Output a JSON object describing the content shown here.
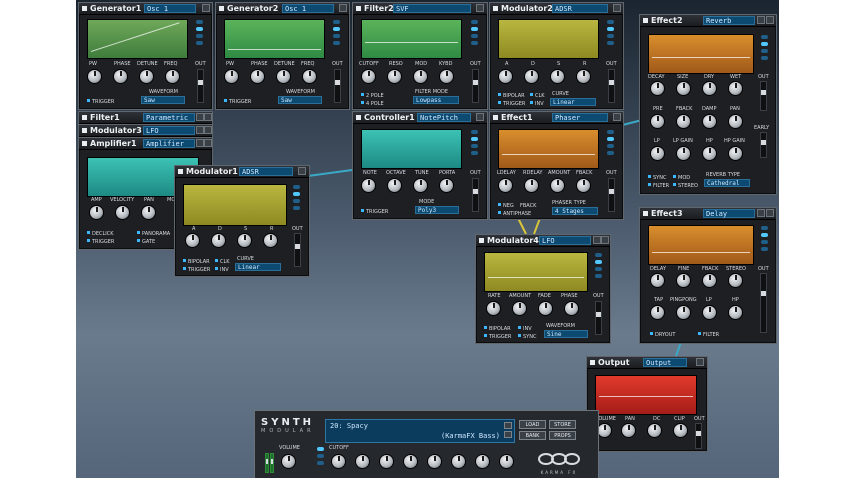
{
  "modules": {
    "generator1": {
      "title": "Generator1",
      "select": "Osc 1",
      "knobs": [
        "PW",
        "PHASE",
        "DETUNE",
        "FREQ"
      ],
      "out": "OUT",
      "waveform_label": "WAVEFORM",
      "waveform": "Saw",
      "trigger": "TRIGGER"
    },
    "generator2": {
      "title": "Generator2",
      "select": "Osc 1",
      "knobs": [
        "PW",
        "PHASE",
        "DETUNE",
        "FREQ"
      ],
      "out": "OUT",
      "waveform_label": "WAVEFORM",
      "waveform": "Saw",
      "trigger": "TRIGGER"
    },
    "filter2": {
      "title": "Filter2",
      "select": "SVF",
      "knobs": [
        "CUTOFF",
        "RESO",
        "MOD",
        "KYBD"
      ],
      "out": "OUT",
      "pole2": "2 POLE",
      "pole4": "4 POLE",
      "mode_label": "FILTER MODE",
      "mode": "Lowpass"
    },
    "modulator2": {
      "title": "Modulator2",
      "select": "ADSR",
      "knobs": [
        "A",
        "D",
        "S",
        "R"
      ],
      "out": "OUT",
      "bipolar": "BIPOLAR",
      "clk": "CLK",
      "trigger": "TRIGGER",
      "inv": "INV",
      "curve_label": "CURVE",
      "curve": "Linear"
    },
    "effect2": {
      "title": "Effect2",
      "select": "Reverb",
      "row1": [
        "DECAY",
        "SIZE",
        "DRY",
        "WET"
      ],
      "row2": [
        "PRE",
        "FBACK",
        "DAMP",
        "PAN"
      ],
      "row3": [
        "LP",
        "LP GAIN",
        "HP",
        "HP GAIN"
      ],
      "out": "OUT",
      "early": "EARLY",
      "sync": "SYNC",
      "mod": "MOD",
      "filter": "FILTER",
      "stereo": "STEREO",
      "type_label": "REVERB TYPE",
      "type": "Cathedral"
    },
    "filter1": {
      "title": "Filter1",
      "select": "Parametric"
    },
    "modulator3": {
      "title": "Modulator3",
      "select": "LFO"
    },
    "amplifier1": {
      "title": "Amplifier1",
      "select": "Amplifier",
      "knobs": [
        "AMP",
        "VELOCITY",
        "PAN",
        "MO"
      ],
      "declick": "DECLICK",
      "panorama": "PANORAMA",
      "trigger": "TRIGGER",
      "gate": "GATE"
    },
    "modulator1": {
      "title": "Modulator1",
      "select": "ADSR",
      "knobs": [
        "A",
        "D",
        "S",
        "R"
      ],
      "out": "OUT",
      "bipolar": "BIPOLAR",
      "clk": "CLK",
      "trigger": "TRIGGER",
      "inv": "INV",
      "curve_label": "CURVE",
      "curve": "Linear"
    },
    "controller1": {
      "title": "Controller1",
      "select": "NotePitch",
      "knobs": [
        "NOTE",
        "OCTAVE",
        "TUNE",
        "PORTA"
      ],
      "out": "OUT",
      "mode_label": "MODE",
      "mode": "Poly3",
      "trigger": "TRIGGER"
    },
    "effect1": {
      "title": "Effect1",
      "select": "Phaser",
      "knobs": [
        "LDELAY",
        "RDELAY",
        "AMOUNT",
        "FBACK"
      ],
      "out": "OUT",
      "neg": "NEG",
      "fback": "FBACK",
      "antiphase": "ANTIPHASE",
      "type_label": "PHASER TYPE",
      "type": "4 Stages"
    },
    "modulator4": {
      "title": "Modulator4",
      "select": "LFO",
      "knobs": [
        "RATE",
        "AMOUNT",
        "FADE",
        "PHASE"
      ],
      "out": "OUT",
      "bipolar": "BIPOLAR",
      "inv": "INV",
      "trigger": "TRIGGER",
      "sync": "SYNC",
      "waveform_label": "WAVEFORM",
      "waveform": "Sine"
    },
    "effect3": {
      "title": "Effect3",
      "select": "Delay",
      "row1": [
        "DELAY",
        "FINE",
        "FBACK",
        "STEREO"
      ],
      "row2": [
        "TAP",
        "PINGPONG",
        "LP",
        "HP"
      ],
      "out": "OUT",
      "dryout": "DRYOUT",
      "filter": "FILTER"
    },
    "output": {
      "title": "Output",
      "select": "Output",
      "knobs": [
        "VOLUME",
        "PAN",
        "DC",
        "CLIP"
      ],
      "out": "OUT"
    }
  },
  "synthbar": {
    "logo_line1": "SYNTH",
    "logo_line2": "MODULAR",
    "volume": "VOLUME",
    "cutoff": "CUTOFF",
    "preset_name": "20: Spacy",
    "preset_author": "(KarmaFX Bass)",
    "load": "LOAD",
    "store": "STORE",
    "bank": "BANK",
    "props": "PROPS",
    "brand": "KARMA FX"
  },
  "colors": {
    "accent": "#52c8ff",
    "select_bg": "#0d4a72"
  }
}
